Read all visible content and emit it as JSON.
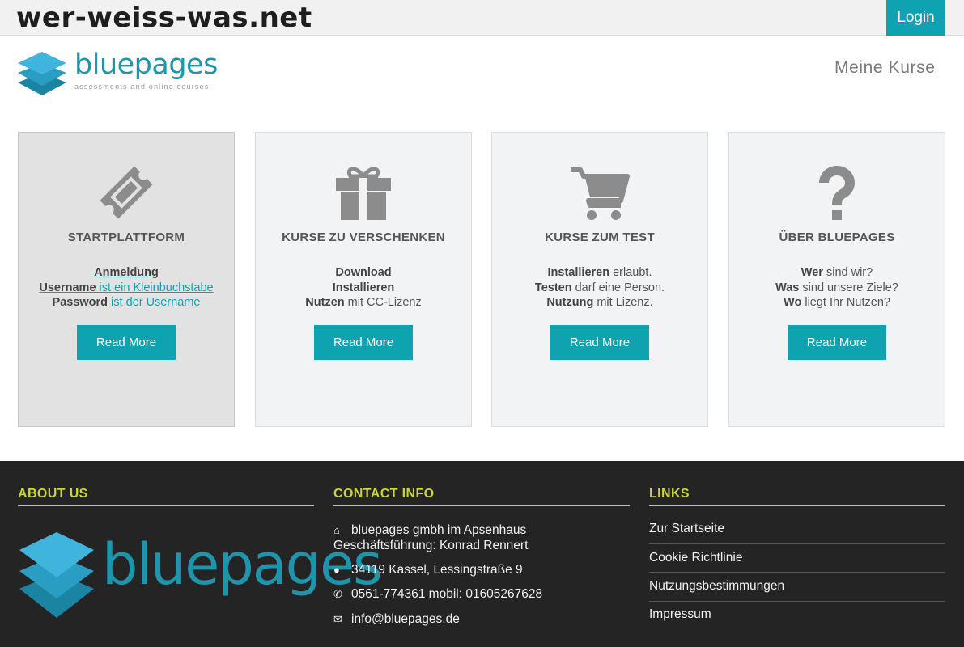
{
  "topbar": {
    "site_title": "wer-weiss-was.net",
    "login_label": "Login"
  },
  "header": {
    "logo_word": "bluepages",
    "logo_tagline": "assessments and online courses",
    "nav_label": "Meine Kurse"
  },
  "cards": [
    {
      "title": "STARTPLATTFORM",
      "icon": "ticket-icon",
      "lines": [
        {
          "strong": "Anmeldung",
          "rest": ""
        },
        {
          "strong": "Username",
          "rest": " ist ein Kleinbuchstabe"
        },
        {
          "strong": "Password",
          "rest": " ist der Username"
        }
      ],
      "button": "Read More"
    },
    {
      "title": "KURSE ZU VERSCHENKEN",
      "icon": "gift-icon",
      "lines": [
        {
          "strong": "Download",
          "rest": ""
        },
        {
          "strong": "Installieren",
          "rest": ""
        },
        {
          "strong": "Nutzen",
          "rest": " mit CC-Lizenz"
        }
      ],
      "button": "Read More"
    },
    {
      "title": "KURSE ZUM TEST",
      "icon": "shopping-cart-icon",
      "lines": [
        {
          "strong": "Installieren",
          "rest": " erlaubt."
        },
        {
          "strong": "Testen",
          "rest": " darf eine Person."
        },
        {
          "strong": "Nutzung",
          "rest": " mit Lizenz."
        }
      ],
      "button": "Read More"
    },
    {
      "title": "ÜBER BLUEPAGES",
      "icon": "question-mark-icon",
      "lines": [
        {
          "strong": "Wer",
          "rest": " sind wir?"
        },
        {
          "strong": "Was",
          "rest": " sind unsere Ziele?"
        },
        {
          "strong": "Wo",
          "rest": " liegt Ihr Nutzen?"
        }
      ],
      "button": "Read More"
    }
  ],
  "footer": {
    "about_heading": "ABOUT US",
    "about_logo_word": "bluepages",
    "contact_heading": "CONTACT INFO",
    "contact": {
      "company": "bluepages gmbh im Apsenhaus",
      "management": "Geschäftsführung: Konrad Rennert",
      "address": "34119 Kassel, Lessingstraße 9",
      "phone": "0561-774361 mobil: 01605267628",
      "email": "info@bluepages.de"
    },
    "links_heading": "LINKS",
    "links": [
      "Zur Startseite",
      "Cookie Richtlinie",
      "Nutzungsbestimmungen",
      "Impressum"
    ]
  },
  "colors": {
    "accent": "#0fa3b1",
    "brand_blue": "#1d96ad",
    "footer_heading": "#c9d630",
    "footer_bg": "#242424"
  }
}
